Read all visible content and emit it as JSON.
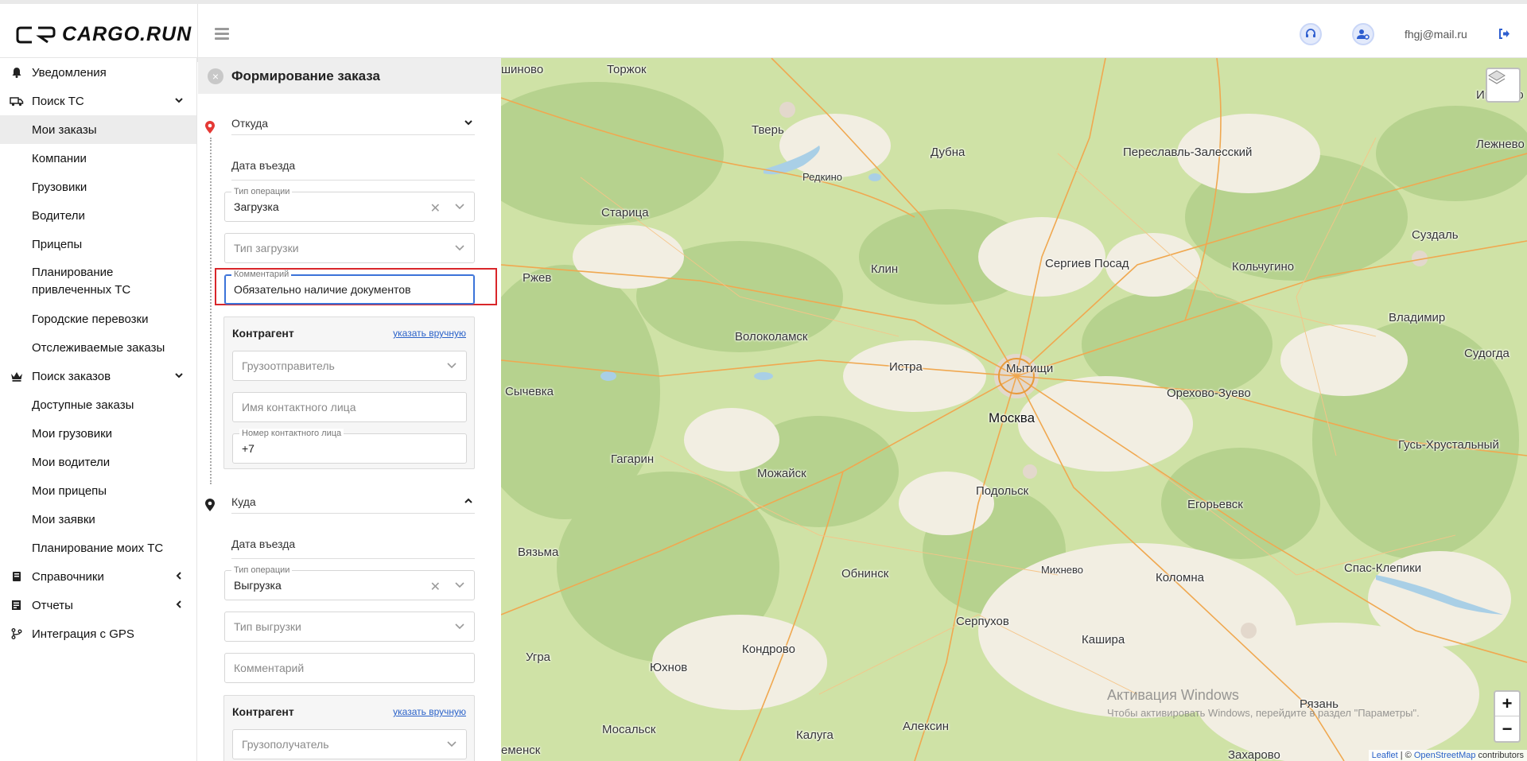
{
  "app": {
    "logo_text": "CARGO.RUN",
    "user_email": "fhgj@mail.ru"
  },
  "icons": {
    "support": "headset-icon",
    "profile": "user-settings-icon",
    "logout": "logout-icon",
    "menu": "hamburger-icon"
  },
  "colors": {
    "accent": "#3b73d9",
    "highlight": "#d9262a",
    "pin_from": "#e53935",
    "link": "#2a62c9"
  },
  "sidebar": {
    "notifications": "Уведомления",
    "search_vehicles": "Поиск ТС",
    "my_orders": "Мои заказы",
    "companies": "Компании",
    "trucks": "Грузовики",
    "drivers": "Водители",
    "trailers": "Прицепы",
    "planning_hired": "Планирование привлеченных ТС",
    "city_transport": "Городские перевозки",
    "tracked_orders": "Отслеживаемые заказы",
    "search_orders": "Поиск заказов",
    "available_orders": "Доступные заказы",
    "my_trucks": "Мои грузовики",
    "my_drivers": "Мои водители",
    "my_trailers": "Мои прицепы",
    "my_requests": "Мои заявки",
    "planning_my": "Планирование моих ТС",
    "references": "Справочники",
    "reports": "Отчеты",
    "gps": "Интеграция с GPS"
  },
  "panel": {
    "title": "Формирование заказа",
    "from": {
      "header": "Откуда",
      "date": "Дата въезда",
      "op_label": "Тип операции",
      "op_value": "Загрузка",
      "load_type": "Тип загрузки",
      "comment_label": "Комментарий",
      "comment_value": "Обязательно наличие документов",
      "counterparty": "Контрагент",
      "manual": "указать вручную",
      "shipper": "Грузоотправитель",
      "contact_name": "Имя контактного лица",
      "contact_phone_label": "Номер контактного лица",
      "contact_phone": "+7"
    },
    "to": {
      "header": "Куда",
      "date": "Дата въезда",
      "op_label": "Тип операции",
      "op_value": "Выгрузка",
      "unload_type": "Тип выгрузки",
      "comment": "Комментарий",
      "counterparty": "Контрагент",
      "manual": "указать вручную",
      "consignee": "Грузополучатель"
    }
  },
  "map": {
    "cities": [
      "шиново",
      "Торжок",
      "Тверь",
      "Дубна",
      "Переславль-Залесский",
      "Лежнево",
      "Иваново",
      "Редкино",
      "Старица",
      "Суздаль",
      "Клин",
      "Сергиев Посад",
      "Кольчугино",
      "Ржев",
      "Владимир",
      "Волоколамск",
      "Истра",
      "Мытищи",
      "Судогда",
      "Сычевка",
      "Орехово-Зуево",
      "Москва",
      "Гусь-Хрустальный",
      "Гагарин",
      "Можайск",
      "Подольск",
      "Егорьевск",
      "Вязьма",
      "Обнинск",
      "Михнево",
      "Коломна",
      "Спас-Клепики",
      "Серпухов",
      "Кашира",
      "Кондрово",
      "Угра",
      "Юхнов",
      "Рязань",
      "Мосальск",
      "Алексин",
      "Калуга",
      "еменск",
      "Захарово"
    ],
    "zoom_in": "+",
    "zoom_out": "−",
    "attribution_leaflet": "Leaflet",
    "attribution_sep": " | © ",
    "attribution_osm": "OpenStreetMap",
    "attribution_tail": " contributors",
    "win_title": "Активация Windows",
    "win_sub": "Чтобы активировать Windows, перейдите в раздел \"Параметры\"."
  }
}
